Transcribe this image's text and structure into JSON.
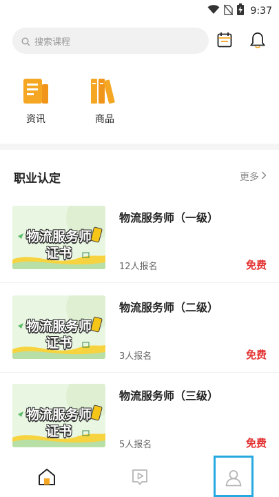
{
  "status_bar": {
    "time": "9:37",
    "icons": [
      "wifi-icon",
      "no-sim-icon",
      "battery-charging-icon"
    ]
  },
  "search": {
    "placeholder": "搜索课程",
    "icons": [
      "search-icon",
      "calendar-icon",
      "bell-icon"
    ]
  },
  "shortcuts": [
    {
      "label": "资讯",
      "icon": "news-icon",
      "color": "#f5a623"
    },
    {
      "label": "商品",
      "icon": "books-icon",
      "color": "#f5a623"
    }
  ],
  "section": {
    "title": "职业认定",
    "more_label": "更多"
  },
  "courses": [
    {
      "title": "物流服务师（一级）",
      "enroll": "12人报名",
      "price": "免费",
      "thumb_line1": "物流服务师",
      "thumb_line2": "证书"
    },
    {
      "title": "物流服务师（二级）",
      "enroll": "3人报名",
      "price": "免费",
      "thumb_line1": "物流服务师",
      "thumb_line2": "证书"
    },
    {
      "title": "物流服务师（三级）",
      "enroll": "5人报名",
      "price": "免费",
      "thumb_line1": "物流服务师",
      "thumb_line2": "证书"
    }
  ],
  "bottom_nav": [
    {
      "icon": "home-icon"
    },
    {
      "icon": "video-icon"
    },
    {
      "icon": "profile-icon"
    }
  ],
  "colors": {
    "accent": "#f5a623",
    "price": "#e33232",
    "selection_frame": "#25a9e0"
  }
}
